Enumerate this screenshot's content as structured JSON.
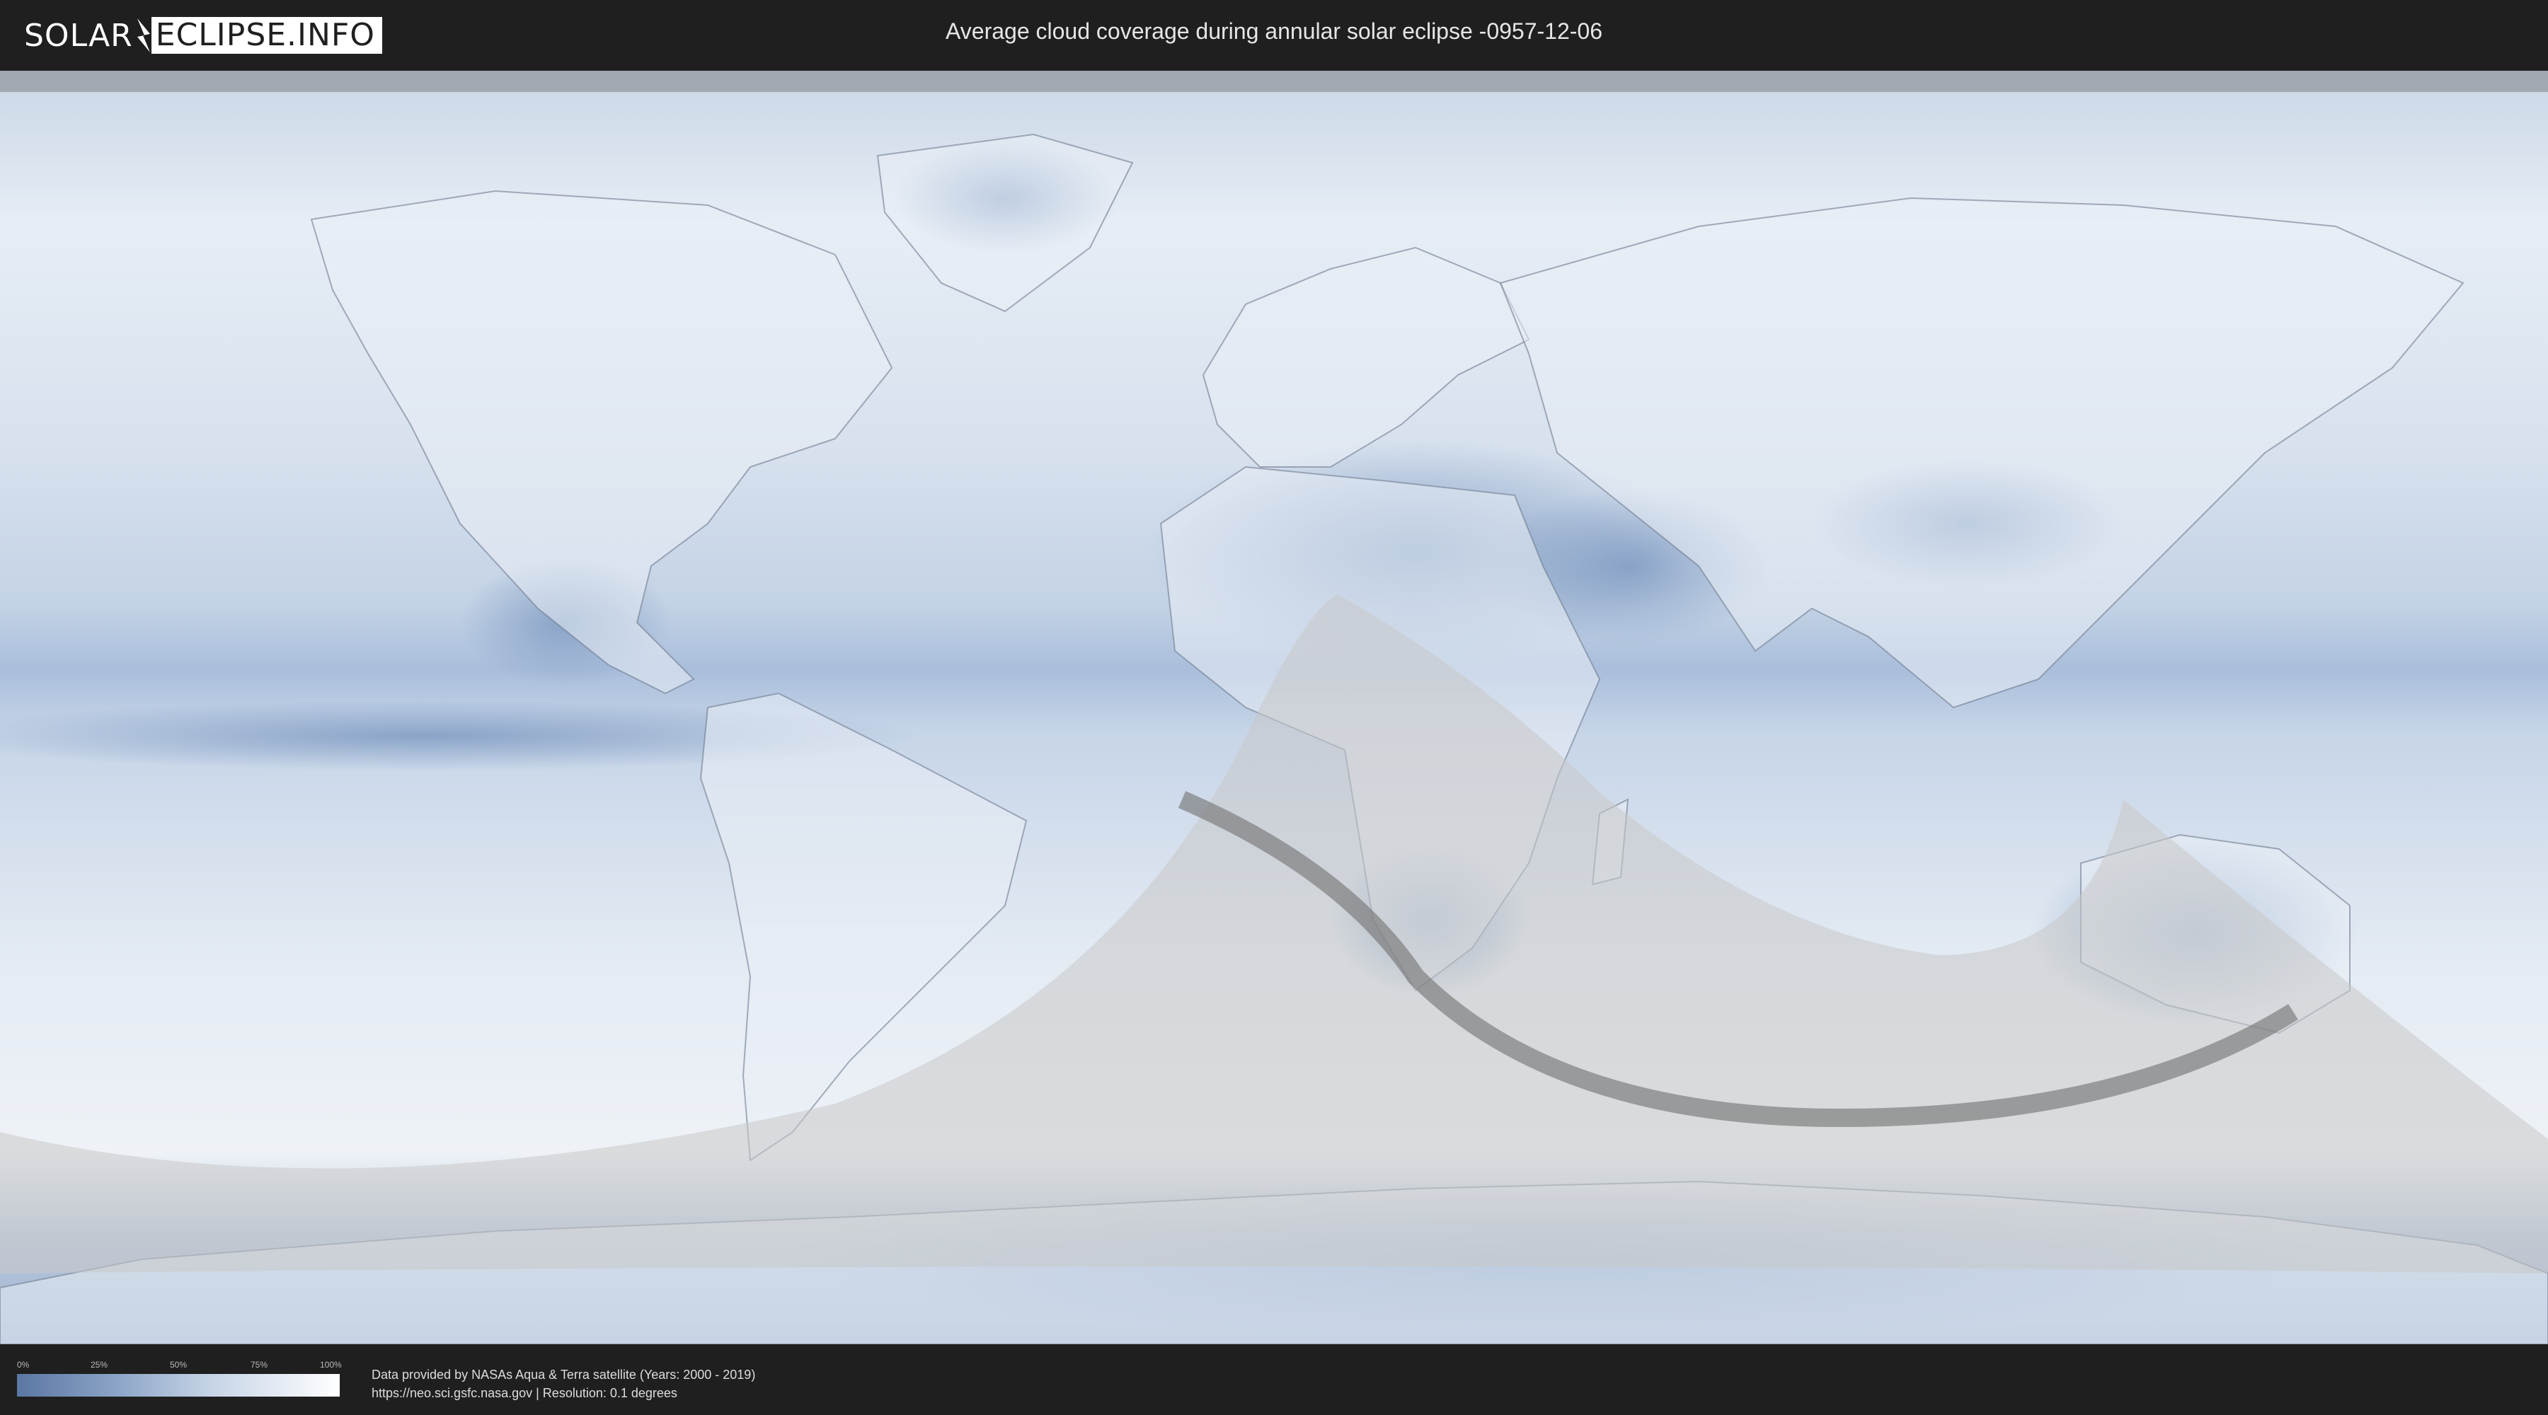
{
  "header": {
    "logo_left": "SOLAR",
    "logo_right": "ECLIPSE.INFO",
    "title": "Average cloud coverage during annular solar eclipse -0957-12-06"
  },
  "legend": {
    "ticks": [
      "0%",
      "25%",
      "50%",
      "75%",
      "100%"
    ],
    "colors": {
      "low": "#5a77a3",
      "high": "#ffffff"
    }
  },
  "footer": {
    "credit_line1": "Data provided by NASAs Aqua & Terra satellite (Years: 2000 - 2019)",
    "credit_line2": "https://neo.sci.gsfc.nasa.gov | Resolution: 0.1 degrees"
  },
  "map": {
    "projection": "equirectangular",
    "colors": {
      "ocean_cloud": "#dfe7f1",
      "clear_sky": "#7f9bc2",
      "visibility_overlay": "#c8c8c8",
      "path": "#6f6f6f"
    }
  }
}
